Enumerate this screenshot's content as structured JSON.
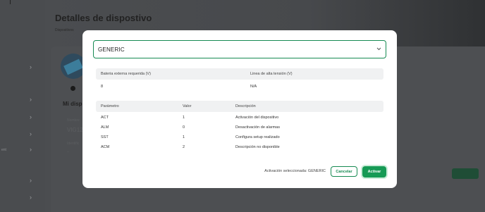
{
  "background": {
    "page_title": "Detalles de dispostivo",
    "breadcrumb": "Dispositivos",
    "section_title": "Mi disp",
    "sidebar_fragment": "ent",
    "faint_fields": [
      "Nombre",
      "VIG123",
      "Identific",
      "--"
    ]
  },
  "modal": {
    "select": {
      "value": "GENERIC"
    },
    "power_table": {
      "headers": [
        "Bateria externa requerida (V)",
        "Linea de alta tensión (V)"
      ],
      "row": [
        "8",
        "N/A"
      ]
    },
    "params_table": {
      "headers": [
        "Parámetro",
        "Valor",
        "Descripción"
      ],
      "rows": [
        [
          "ACT",
          "1",
          "Activación del dispositivo"
        ],
        [
          "ALM",
          "0",
          "Desactivación de alarmas"
        ],
        [
          "SST",
          "1",
          "Configura setup realizado"
        ],
        [
          "ACM",
          "2",
          "Descripción no disponible"
        ]
      ]
    },
    "footer": {
      "selected_label": "Activación seleccionada: GENERIC",
      "cancel_label": "Cancelar",
      "activate_label": "Activar"
    }
  },
  "colors": {
    "accent": "#169a55",
    "overlay": "#3a3c3f"
  }
}
